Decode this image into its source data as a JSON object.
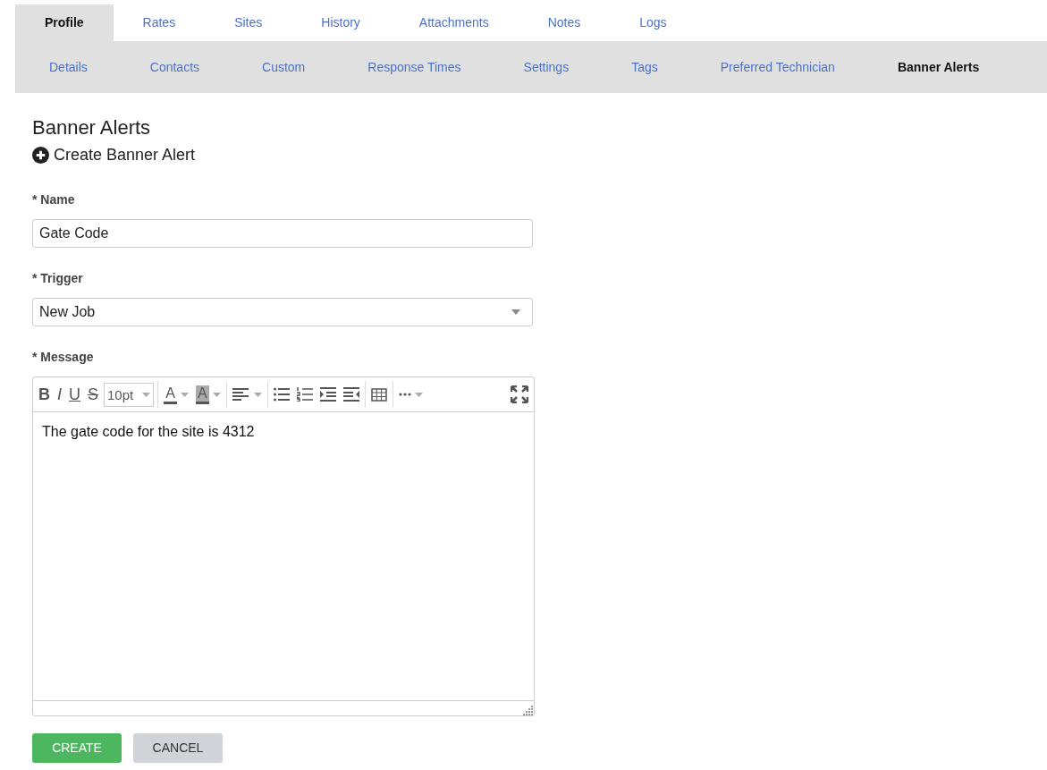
{
  "tabs": [
    {
      "label": "Profile",
      "selected": true
    },
    {
      "label": "Rates",
      "selected": false
    },
    {
      "label": "Sites",
      "selected": false
    },
    {
      "label": "History",
      "selected": false
    },
    {
      "label": "Attachments",
      "selected": false
    },
    {
      "label": "Notes",
      "selected": false
    },
    {
      "label": "Logs",
      "selected": false
    }
  ],
  "subtabs": [
    {
      "label": "Details",
      "selected": false
    },
    {
      "label": "Contacts",
      "selected": false
    },
    {
      "label": "Custom",
      "selected": false
    },
    {
      "label": "Response Times",
      "selected": false
    },
    {
      "label": "Settings",
      "selected": false
    },
    {
      "label": "Tags",
      "selected": false
    },
    {
      "label": "Preferred Technician",
      "selected": false
    },
    {
      "label": "Banner Alerts",
      "selected": true
    }
  ],
  "heading": "Banner Alerts",
  "create_link": "Create Banner Alert",
  "fields": [
    {
      "kind": "text",
      "label": "* Name",
      "value": "Gate Code"
    },
    {
      "kind": "select",
      "label": "* Trigger",
      "value": "New Job"
    }
  ],
  "message": {
    "label": "* Message",
    "toolbar": [
      {
        "kind": "bold",
        "text": "B"
      },
      {
        "kind": "italic",
        "text": "I"
      },
      {
        "kind": "underline",
        "text": "U"
      },
      {
        "kind": "strike",
        "text": "S"
      },
      {
        "kind": "size",
        "text": "10pt"
      },
      {
        "kind": "sep"
      },
      {
        "kind": "textcolor",
        "text": "A"
      },
      {
        "kind": "highlight",
        "text": "A"
      },
      {
        "kind": "sep"
      },
      {
        "kind": "align"
      },
      {
        "kind": "sep"
      },
      {
        "kind": "bullets"
      },
      {
        "kind": "numbers"
      },
      {
        "kind": "indent"
      },
      {
        "kind": "outdent"
      },
      {
        "kind": "sep"
      },
      {
        "kind": "table"
      },
      {
        "kind": "sep"
      },
      {
        "kind": "more"
      }
    ],
    "body": "The gate code for the site is 4312"
  },
  "buttons": [
    {
      "kind": "primary",
      "label": "CREATE"
    },
    {
      "kind": "secondary",
      "label": "CANCEL"
    }
  ]
}
